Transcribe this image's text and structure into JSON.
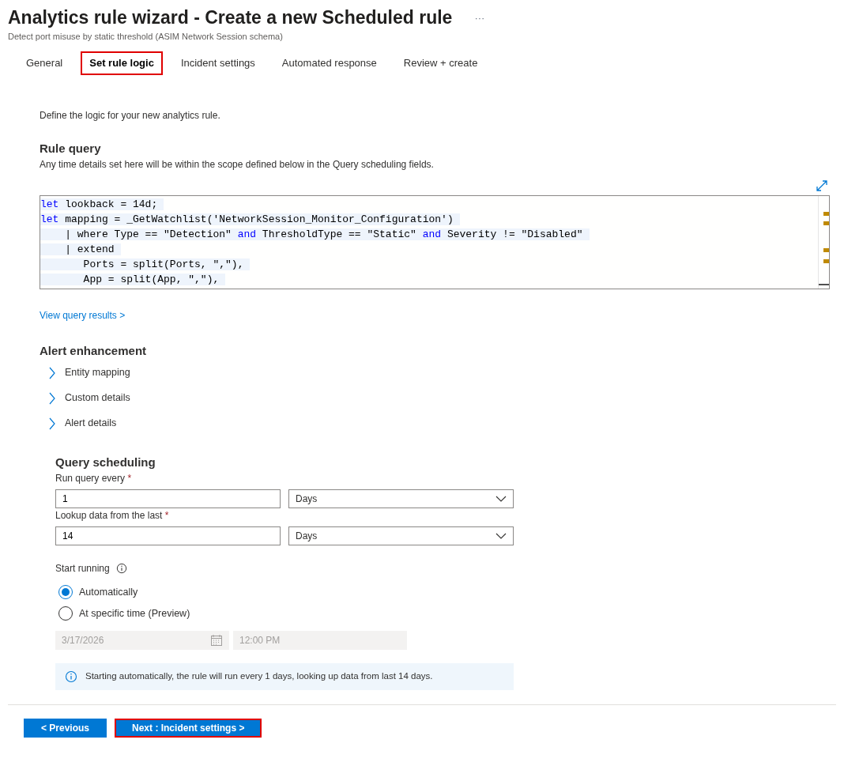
{
  "header": {
    "title": "Analytics rule wizard - Create a new Scheduled rule",
    "more": "···",
    "subtitle": "Detect port misuse by static threshold (ASIM Network Session schema)"
  },
  "tabs": [
    {
      "label": "General",
      "selected": false,
      "highlighted": false
    },
    {
      "label": "Set rule logic",
      "selected": true,
      "highlighted": true
    },
    {
      "label": "Incident settings",
      "selected": false,
      "highlighted": false
    },
    {
      "label": "Automated response",
      "selected": false,
      "highlighted": false
    },
    {
      "label": "Review + create",
      "selected": false,
      "highlighted": false
    }
  ],
  "intro": "Define the logic for your new analytics rule.",
  "rule_query": {
    "heading": "Rule query",
    "description": "Any time details set here will be within the scope defined below in the Query scheduling fields.",
    "code_lines": [
      [
        {
          "kind": "keyword",
          "text": "let"
        },
        {
          "kind": "plain",
          "text": " lookback = 14d;"
        }
      ],
      [
        {
          "kind": "keyword",
          "text": "let"
        },
        {
          "kind": "plain",
          "text": " mapping = _GetWatchlist('NetworkSession_Monitor_Configuration')"
        }
      ],
      [
        {
          "kind": "plain",
          "text": "    | where Type == \"Detection\" "
        },
        {
          "kind": "keyword",
          "text": "and"
        },
        {
          "kind": "plain",
          "text": " ThresholdType == \"Static\" "
        },
        {
          "kind": "keyword",
          "text": "and"
        },
        {
          "kind": "plain",
          "text": " Severity != \"Disabled\""
        }
      ],
      [
        {
          "kind": "plain",
          "text": "    | extend"
        }
      ],
      [
        {
          "kind": "plain",
          "text": "       Ports = split(Ports, \",\"),"
        }
      ],
      [
        {
          "kind": "plain",
          "text": "       App = split(App, \",\"),"
        }
      ]
    ],
    "link": "View query results >"
  },
  "alert_enhancement": {
    "heading": "Alert enhancement",
    "items": [
      {
        "label": "Entity mapping",
        "expanded": false
      },
      {
        "label": "Custom details",
        "expanded": false
      },
      {
        "label": "Alert details",
        "expanded": false
      }
    ]
  },
  "scheduling": {
    "heading": "Query scheduling",
    "fields": [
      {
        "label": "Run query every",
        "required": "*",
        "value": "1",
        "unit": "Days"
      },
      {
        "label": "Lookup data from the last",
        "required": "*",
        "value": "14",
        "unit": "Days"
      }
    ],
    "start_label": "Start running",
    "options": [
      {
        "label": "Automatically",
        "selected": true
      },
      {
        "label": "At specific time (Preview)",
        "selected": false
      }
    ],
    "date": "3/17/2026",
    "time": "12:00 PM",
    "info": "Starting automatically, the rule will run every 1 days, looking up data from last 14 days."
  },
  "footer": {
    "buttons": [
      {
        "label": "< Previous",
        "highlighted": false
      },
      {
        "label": "Next : Incident settings >",
        "highlighted": true
      }
    ]
  }
}
